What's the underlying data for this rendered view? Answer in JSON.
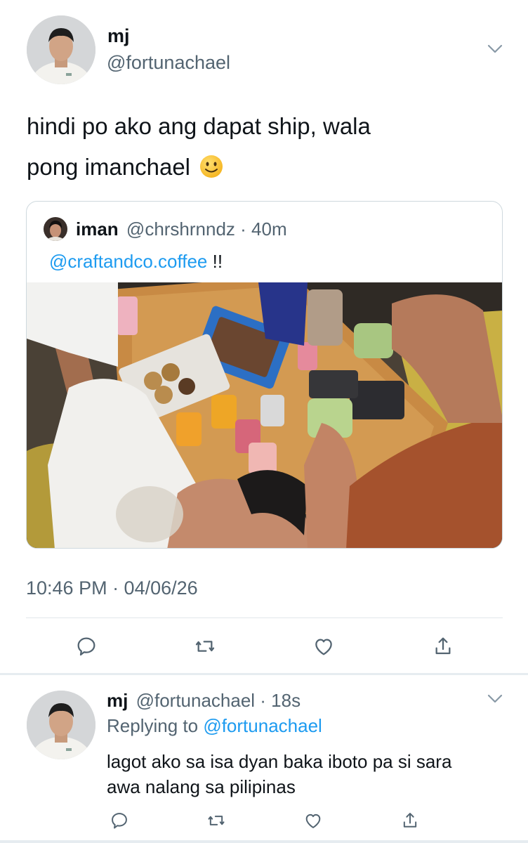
{
  "main_tweet": {
    "display_name": "mj",
    "handle": "@fortunachael",
    "text_line1": "hindi po ako ang dapat ship, wala",
    "text_line2": "pong imanchael",
    "timestamp": "10:46 PM · 04/06/26",
    "quote": {
      "display_name": "iman",
      "handle_time": "@chrshrnndz · 40m",
      "mention": "@craftandco.coffee",
      "suffix": " !!"
    }
  },
  "reply_tweet": {
    "display_name": "mj",
    "handle_time": "@fortunachael · 18s",
    "replying_prefix": "Replying to ",
    "replying_handle": "@fortunachael",
    "text_line1": "lagot ako sa isa dyan baka iboto pa si sara",
    "text_line2": "awa nalang sa pilipinas"
  },
  "icons": {
    "reply": "reply-icon",
    "retweet": "retweet-icon",
    "like": "like-icon",
    "share": "share-icon",
    "more": "chevron-down-icon"
  },
  "colors": {
    "link": "#1d9bf0",
    "secondary_text": "#536471",
    "divider": "#e1e6ea"
  }
}
